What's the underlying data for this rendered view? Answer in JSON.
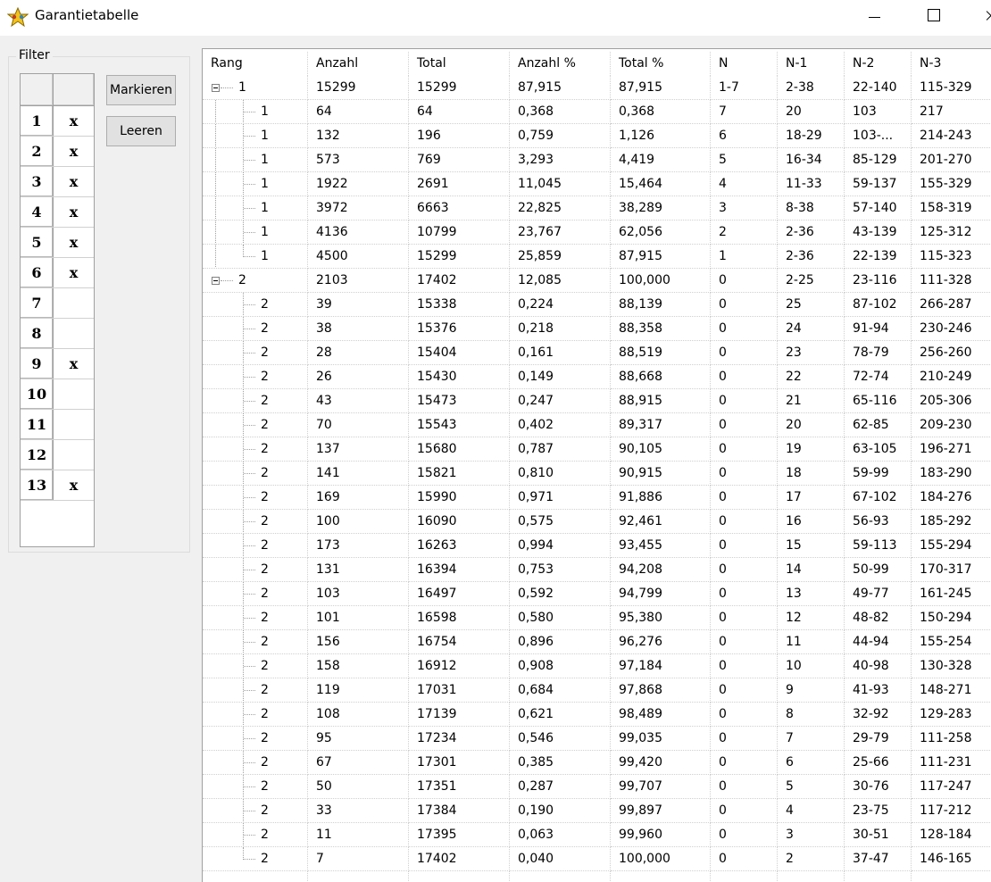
{
  "window": {
    "title": "Garantietabelle"
  },
  "filter": {
    "legend": "Filter",
    "buttons": {
      "mark": "Markieren",
      "clear": "Leeren"
    },
    "rows": [
      {
        "num": "1",
        "val": "x"
      },
      {
        "num": "2",
        "val": "x"
      },
      {
        "num": "3",
        "val": "x"
      },
      {
        "num": "4",
        "val": "x"
      },
      {
        "num": "5",
        "val": "x"
      },
      {
        "num": "6",
        "val": "x"
      },
      {
        "num": "7",
        "val": ""
      },
      {
        "num": "8",
        "val": ""
      },
      {
        "num": "9",
        "val": "x"
      },
      {
        "num": "10",
        "val": ""
      },
      {
        "num": "11",
        "val": ""
      },
      {
        "num": "12",
        "val": ""
      },
      {
        "num": "13",
        "val": "x"
      }
    ]
  },
  "table": {
    "columns": [
      "Rang",
      "Anzahl",
      "Total",
      "Anzahl %",
      "Total %",
      "N",
      "N-1",
      "N-2",
      "N-3"
    ],
    "rows": [
      {
        "level": 0,
        "cells": [
          "1",
          "15299",
          "15299",
          "87,915",
          "87,915",
          "1-7",
          "2-38",
          "22-140",
          "115-329"
        ]
      },
      {
        "level": 1,
        "cells": [
          "1",
          "64",
          "64",
          "0,368",
          "0,368",
          "7",
          "20",
          "103",
          "217"
        ]
      },
      {
        "level": 1,
        "cells": [
          "1",
          "132",
          "196",
          "0,759",
          "1,126",
          "6",
          "18-29",
          "103-...",
          "214-243"
        ]
      },
      {
        "level": 1,
        "cells": [
          "1",
          "573",
          "769",
          "3,293",
          "4,419",
          "5",
          "16-34",
          "85-129",
          "201-270"
        ]
      },
      {
        "level": 1,
        "cells": [
          "1",
          "1922",
          "2691",
          "11,045",
          "15,464",
          "4",
          "11-33",
          "59-137",
          "155-329"
        ]
      },
      {
        "level": 1,
        "cells": [
          "1",
          "3972",
          "6663",
          "22,825",
          "38,289",
          "3",
          "8-38",
          "57-140",
          "158-319"
        ]
      },
      {
        "level": 1,
        "cells": [
          "1",
          "4136",
          "10799",
          "23,767",
          "62,056",
          "2",
          "2-36",
          "43-139",
          "125-312"
        ]
      },
      {
        "level": 1,
        "cells": [
          "1",
          "4500",
          "15299",
          "25,859",
          "87,915",
          "1",
          "2-36",
          "22-139",
          "115-323"
        ]
      },
      {
        "level": 0,
        "cells": [
          "2",
          "2103",
          "17402",
          "12,085",
          "100,000",
          "0",
          "2-25",
          "23-116",
          "111-328"
        ]
      },
      {
        "level": 1,
        "cells": [
          "2",
          "39",
          "15338",
          "0,224",
          "88,139",
          "0",
          "25",
          "87-102",
          "266-287"
        ]
      },
      {
        "level": 1,
        "cells": [
          "2",
          "38",
          "15376",
          "0,218",
          "88,358",
          "0",
          "24",
          "91-94",
          "230-246"
        ]
      },
      {
        "level": 1,
        "cells": [
          "2",
          "28",
          "15404",
          "0,161",
          "88,519",
          "0",
          "23",
          "78-79",
          "256-260"
        ]
      },
      {
        "level": 1,
        "cells": [
          "2",
          "26",
          "15430",
          "0,149",
          "88,668",
          "0",
          "22",
          "72-74",
          "210-249"
        ]
      },
      {
        "level": 1,
        "cells": [
          "2",
          "43",
          "15473",
          "0,247",
          "88,915",
          "0",
          "21",
          "65-116",
          "205-306"
        ]
      },
      {
        "level": 1,
        "cells": [
          "2",
          "70",
          "15543",
          "0,402",
          "89,317",
          "0",
          "20",
          "62-85",
          "209-230"
        ]
      },
      {
        "level": 1,
        "cells": [
          "2",
          "137",
          "15680",
          "0,787",
          "90,105",
          "0",
          "19",
          "63-105",
          "196-271"
        ]
      },
      {
        "level": 1,
        "cells": [
          "2",
          "141",
          "15821",
          "0,810",
          "90,915",
          "0",
          "18",
          "59-99",
          "183-290"
        ]
      },
      {
        "level": 1,
        "cells": [
          "2",
          "169",
          "15990",
          "0,971",
          "91,886",
          "0",
          "17",
          "67-102",
          "184-276"
        ]
      },
      {
        "level": 1,
        "cells": [
          "2",
          "100",
          "16090",
          "0,575",
          "92,461",
          "0",
          "16",
          "56-93",
          "185-292"
        ]
      },
      {
        "level": 1,
        "cells": [
          "2",
          "173",
          "16263",
          "0,994",
          "93,455",
          "0",
          "15",
          "59-113",
          "155-294"
        ]
      },
      {
        "level": 1,
        "cells": [
          "2",
          "131",
          "16394",
          "0,753",
          "94,208",
          "0",
          "14",
          "50-99",
          "170-317"
        ]
      },
      {
        "level": 1,
        "cells": [
          "2",
          "103",
          "16497",
          "0,592",
          "94,799",
          "0",
          "13",
          "49-77",
          "161-245"
        ]
      },
      {
        "level": 1,
        "cells": [
          "2",
          "101",
          "16598",
          "0,580",
          "95,380",
          "0",
          "12",
          "48-82",
          "150-294"
        ]
      },
      {
        "level": 1,
        "cells": [
          "2",
          "156",
          "16754",
          "0,896",
          "96,276",
          "0",
          "11",
          "44-94",
          "155-254"
        ]
      },
      {
        "level": 1,
        "cells": [
          "2",
          "158",
          "16912",
          "0,908",
          "97,184",
          "0",
          "10",
          "40-98",
          "130-328"
        ]
      },
      {
        "level": 1,
        "cells": [
          "2",
          "119",
          "17031",
          "0,684",
          "97,868",
          "0",
          "9",
          "41-93",
          "148-271"
        ]
      },
      {
        "level": 1,
        "cells": [
          "2",
          "108",
          "17139",
          "0,621",
          "98,489",
          "0",
          "8",
          "32-92",
          "129-283"
        ]
      },
      {
        "level": 1,
        "cells": [
          "2",
          "95",
          "17234",
          "0,546",
          "99,035",
          "0",
          "7",
          "29-79",
          "111-258"
        ]
      },
      {
        "level": 1,
        "cells": [
          "2",
          "67",
          "17301",
          "0,385",
          "99,420",
          "0",
          "6",
          "25-66",
          "111-231"
        ]
      },
      {
        "level": 1,
        "cells": [
          "2",
          "50",
          "17351",
          "0,287",
          "99,707",
          "0",
          "5",
          "30-76",
          "117-247"
        ]
      },
      {
        "level": 1,
        "cells": [
          "2",
          "33",
          "17384",
          "0,190",
          "99,897",
          "0",
          "4",
          "23-75",
          "117-212"
        ]
      },
      {
        "level": 1,
        "cells": [
          "2",
          "11",
          "17395",
          "0,063",
          "99,960",
          "0",
          "3",
          "30-51",
          "128-184"
        ]
      },
      {
        "level": 1,
        "cells": [
          "2",
          "7",
          "17402",
          "0,040",
          "100,000",
          "0",
          "2",
          "37-47",
          "146-165"
        ]
      }
    ]
  }
}
